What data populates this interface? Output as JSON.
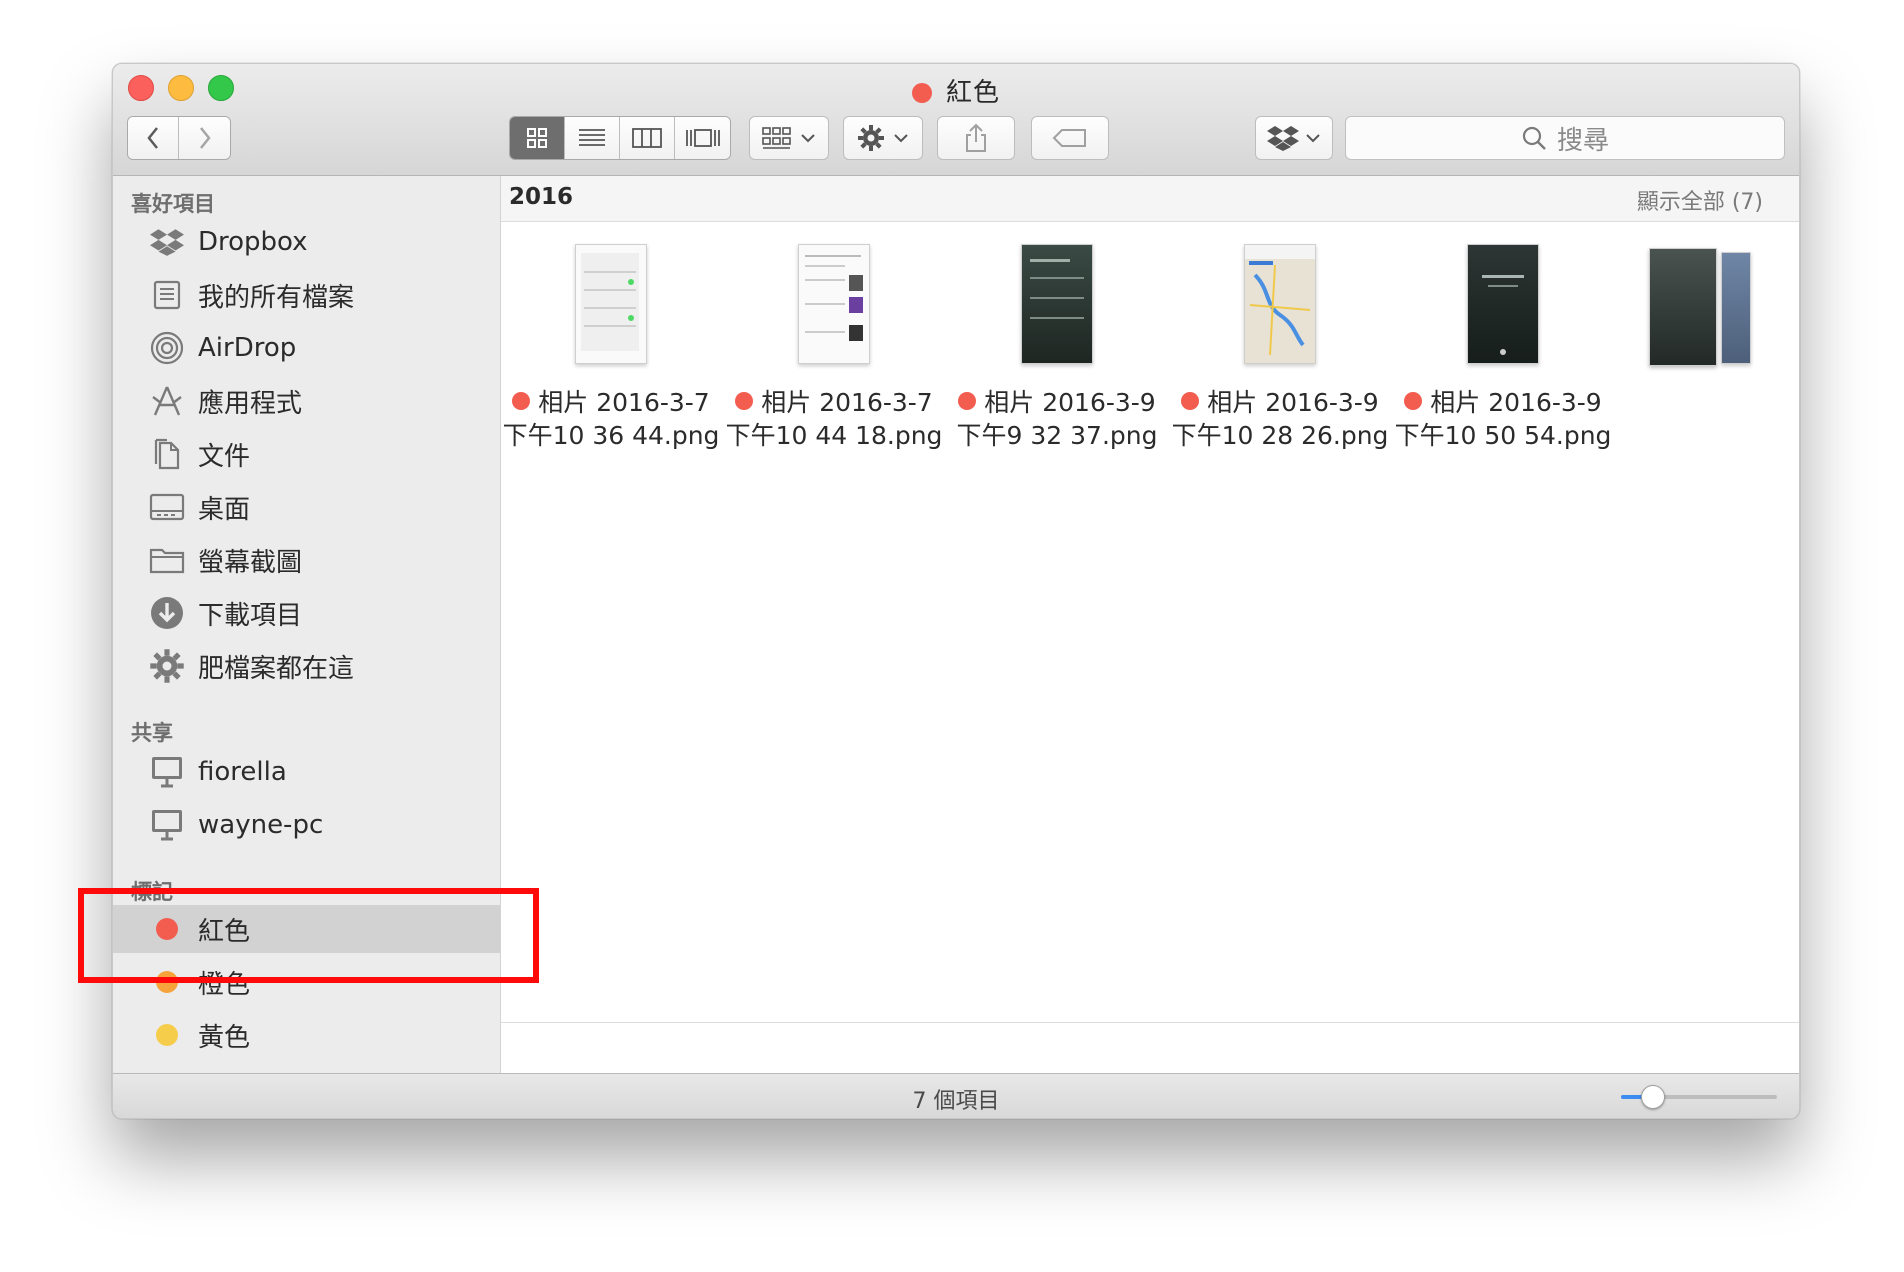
{
  "window": {
    "title": "紅色",
    "title_tag_color": "#f25d50"
  },
  "toolbar": {
    "back_icon": "chevron-left-icon",
    "forward_icon": "chevron-right-icon",
    "view_modes": [
      "icon-view",
      "list-view",
      "column-view",
      "cover-flow-view"
    ],
    "active_view": "icon-view",
    "search_placeholder": "搜尋"
  },
  "sidebar": {
    "favorites_label": "喜好項目",
    "favorites": [
      {
        "label": "Dropbox",
        "icon": "dropbox-icon"
      },
      {
        "label": "我的所有檔案",
        "icon": "all-files-icon"
      },
      {
        "label": "AirDrop",
        "icon": "airdrop-icon"
      },
      {
        "label": "應用程式",
        "icon": "applications-icon"
      },
      {
        "label": "文件",
        "icon": "documents-icon"
      },
      {
        "label": "桌面",
        "icon": "desktop-icon"
      },
      {
        "label": "螢幕截圖",
        "icon": "folder-icon"
      },
      {
        "label": "下載項目",
        "icon": "downloads-icon"
      },
      {
        "label": "肥檔案都在這",
        "icon": "gear-icon"
      }
    ],
    "shared_label": "共享",
    "shared": [
      {
        "label": "fiorella",
        "icon": "computer-icon"
      },
      {
        "label": "wayne-pc",
        "icon": "computer-icon"
      }
    ],
    "tags_label": "標記",
    "tags": [
      {
        "label": "紅色",
        "color": "#f25d50",
        "selected": true
      },
      {
        "label": "橙色",
        "color": "#f7a33c",
        "selected": false
      },
      {
        "label": "黃色",
        "color": "#f6cd4a",
        "selected": false
      }
    ]
  },
  "content": {
    "group_title": "2016",
    "show_all": "顯示全部 (7)",
    "files": [
      {
        "line1": "相片 2016-3-7",
        "line2": "下午10 36 44.png",
        "tag_color": "#f25d50",
        "thumb": "light"
      },
      {
        "line1": "相片 2016-3-7",
        "line2": "下午10 44 18.png",
        "tag_color": "#f25d50",
        "thumb": "news"
      },
      {
        "line1": "相片 2016-3-9",
        "line2": "下午9 32 37.png",
        "tag_color": "#f25d50",
        "thumb": "dark"
      },
      {
        "line1": "相片 2016-3-9",
        "line2": "下午10 28 26.png",
        "tag_color": "#f25d50",
        "thumb": "map"
      },
      {
        "line1": "相片 2016-3-9",
        "line2": "下午10 50 54.png",
        "tag_color": "#f25d50",
        "thumb": "dark"
      }
    ]
  },
  "statusbar": {
    "item_count": "7 個項目",
    "icon_size_fraction": 0.2
  },
  "colors": {
    "accent": "#3b8cf1",
    "annotation": "#ff0a0a"
  }
}
